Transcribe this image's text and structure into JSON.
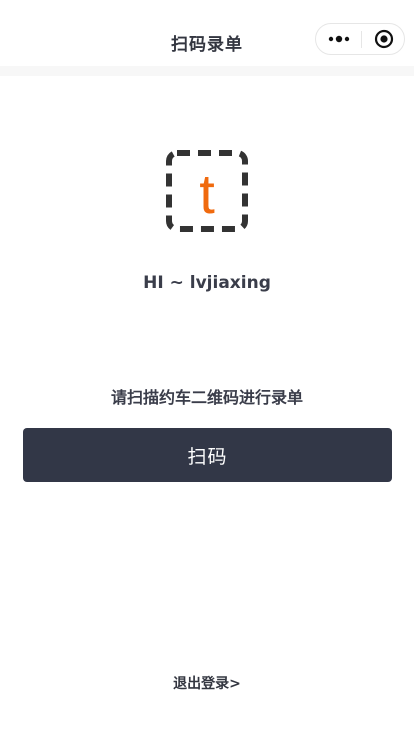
{
  "navbar": {
    "title": "扫码录单",
    "more_icon": "more-dots-icon",
    "close_icon": "target-close-icon"
  },
  "logo": {
    "letter": "t",
    "accent_color": "#f06a0e",
    "frame_color": "#333333"
  },
  "greeting": "HI ~ lvjiaxing",
  "instruction": "请扫描约车二维码进行录单",
  "scan_button": {
    "label": "扫码",
    "color": "#323747"
  },
  "logout": {
    "label": "退出登录>"
  }
}
